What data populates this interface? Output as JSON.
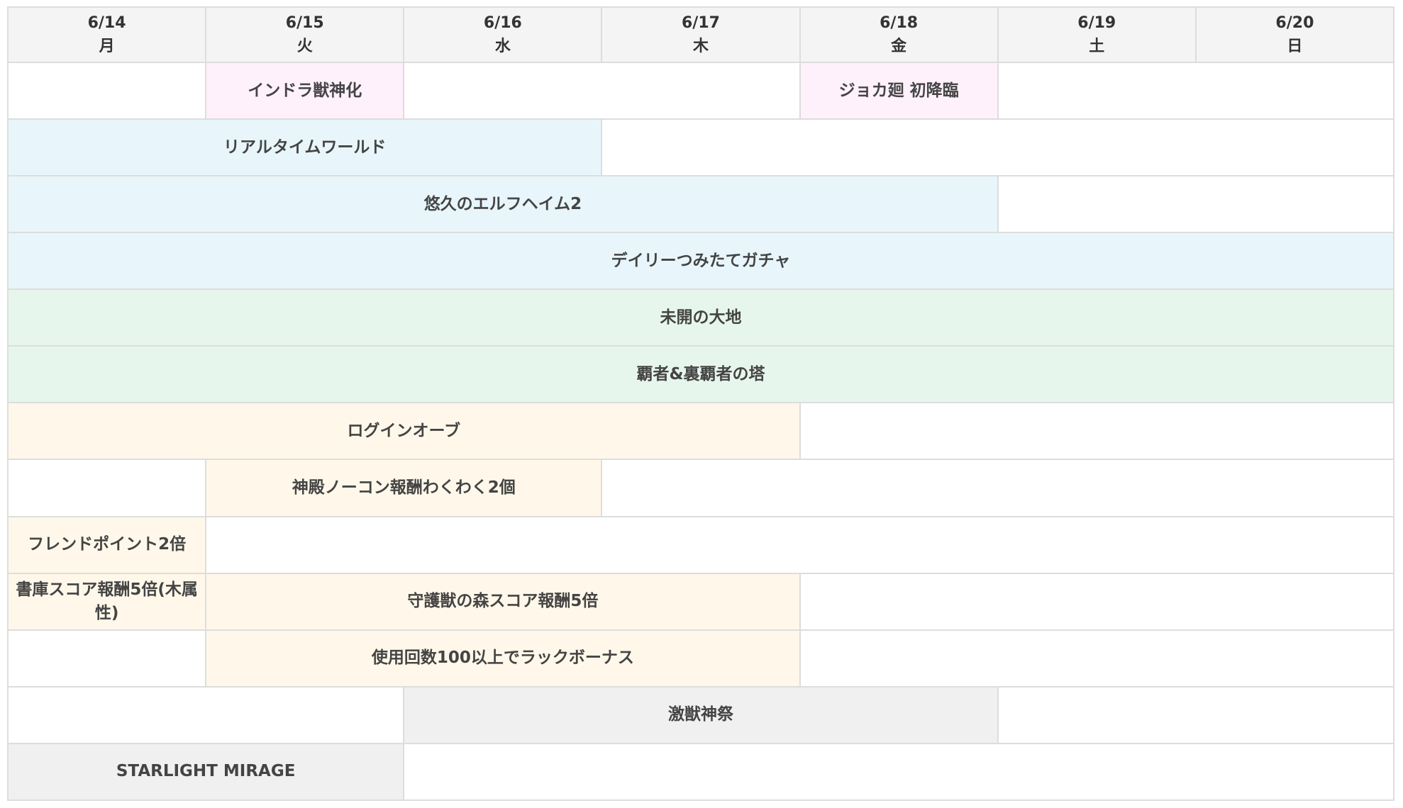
{
  "days": [
    {
      "date": "6/14",
      "dow": "月"
    },
    {
      "date": "6/15",
      "dow": "火"
    },
    {
      "date": "6/16",
      "dow": "水"
    },
    {
      "date": "6/17",
      "dow": "木"
    },
    {
      "date": "6/18",
      "dow": "金"
    },
    {
      "date": "6/19",
      "dow": "土"
    },
    {
      "date": "6/20",
      "dow": "日"
    }
  ],
  "colors": {
    "pink": "#fff1fb",
    "blue": "#e8f6fb",
    "green": "#e7f6ec",
    "cream": "#fff8ea",
    "gray": "#f0f0f0"
  },
  "events": {
    "indra": "インドラ獣神化",
    "jyoka": "ジョカ廻 初降臨",
    "realtime_world": "リアルタイムワールド",
    "elfheim": "悠久のエルフヘイム2",
    "daily_gacha": "デイリーつみたてガチャ",
    "mikai": "未開の大地",
    "haja_tower": "覇者&裏覇者の塔",
    "login_orb": "ログインオーブ",
    "shinden": "神殿ノーコン報酬わくわく2個",
    "friend_point": "フレンドポイント2倍",
    "shoko": "書庫スコア報酬5倍(木属性)",
    "shugoju": "守護獣の森スコア報酬5倍",
    "luck_bonus": "使用回数100以上でラックボーナス",
    "gekijuu": "激獣神祭",
    "starlight": "STARLIGHT MIRAGE"
  }
}
